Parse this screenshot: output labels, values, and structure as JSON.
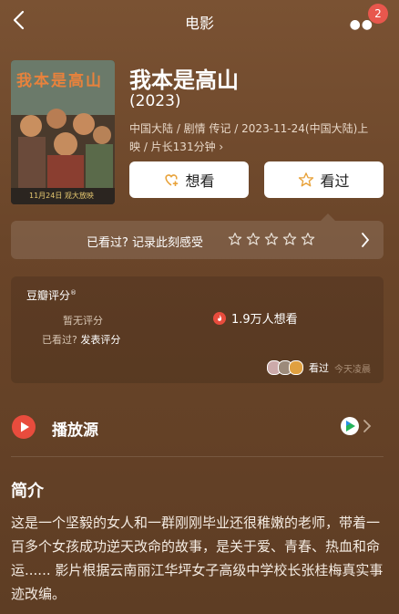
{
  "nav": {
    "title": "电影",
    "badge": "2"
  },
  "movie": {
    "title": "我本是高山",
    "year": "(2023)",
    "meta_line1": "中国大陆 / 剧情 传记 / 2023-11-24(中国大陆)上",
    "meta_line2": "映 / 片长131分钟",
    "poster": {
      "title_art": "我本是高山",
      "date_text": "11月24日 观大放映"
    }
  },
  "actions": {
    "want_label": "想看",
    "seen_label": "看过"
  },
  "rating_prompt": {
    "text": "已看过? 记录此刻感受",
    "star_count": 5
  },
  "score": {
    "label": "豆瓣评分",
    "label_mark": "®",
    "no_score": "暂无评分",
    "seen_question": "已看过?",
    "post_rating": "发表评分",
    "want_count": "1.9万人想看",
    "seen_label": "看过",
    "seen_time": "今天凌晨"
  },
  "play_source": {
    "label": "播放源"
  },
  "intro": {
    "heading": "简介",
    "text": "这是一个坚毅的女人和一群刚刚毕业还很稚嫩的老师，带着一百多个女孩成功逆天改命的故事，是关于爱、青春、热血和命运...... 影片根据云南丽江华坪女子高级中学校长张桂梅真实事迹改编。"
  },
  "colors": {
    "background": "#6e4a2c",
    "accent_red": "#e84c3d",
    "badge": "#e8574d"
  }
}
